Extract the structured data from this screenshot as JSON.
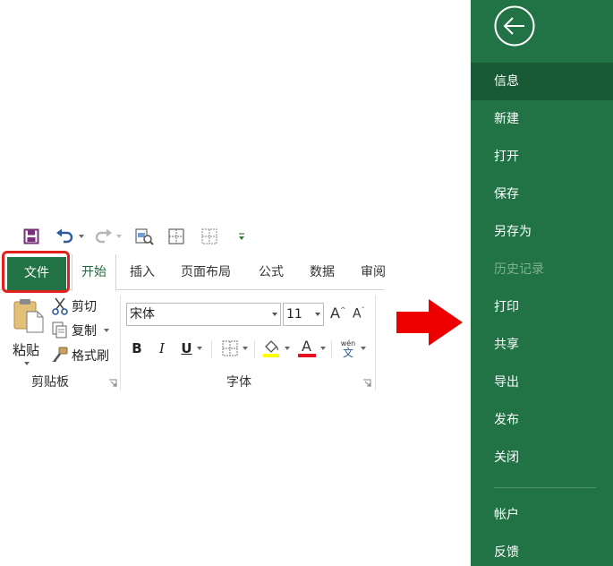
{
  "quick_access": {
    "icons": [
      "save-icon",
      "undo-icon",
      "redo-icon",
      "print-preview-icon",
      "borders-icon",
      "merge-cells-icon",
      "customize-qat-icon"
    ]
  },
  "tabs": {
    "file": "文件",
    "home": "开始",
    "insert": "插入",
    "page_layout": "页面布局",
    "formulas": "公式",
    "data": "数据",
    "review": "审阅"
  },
  "clipboard": {
    "paste": "粘贴",
    "cut": "剪切",
    "copy": "复制",
    "format_painter": "格式刷",
    "group_label": "剪贴板"
  },
  "font": {
    "font_name": "宋体",
    "font_size": "11",
    "bold": "B",
    "italic": "I",
    "underline": "U",
    "font_color_glyph": "A",
    "grow_font": "A",
    "shrink_font": "A",
    "phonetic_top": "wén",
    "phonetic_bottom": "文",
    "group_label": "字体"
  },
  "colors": {
    "excel_green": "#217346",
    "selected_green": "#185a35",
    "highlight_red": "#e0231a",
    "fill_yellow": "#ffff00",
    "font_red": "#e81123"
  },
  "backstage": {
    "items": [
      {
        "label": "信息",
        "state": "selected"
      },
      {
        "label": "新建",
        "state": "normal"
      },
      {
        "label": "打开",
        "state": "normal"
      },
      {
        "label": "保存",
        "state": "normal"
      },
      {
        "label": "另存为",
        "state": "normal"
      },
      {
        "label": "历史记录",
        "state": "disabled"
      },
      {
        "label": "打印",
        "state": "normal"
      },
      {
        "label": "共享",
        "state": "normal"
      },
      {
        "label": "导出",
        "state": "normal"
      },
      {
        "label": "发布",
        "state": "normal"
      },
      {
        "label": "关闭",
        "state": "normal"
      },
      {
        "label": "帐户",
        "state": "normal"
      },
      {
        "label": "反馈",
        "state": "normal"
      }
    ]
  }
}
